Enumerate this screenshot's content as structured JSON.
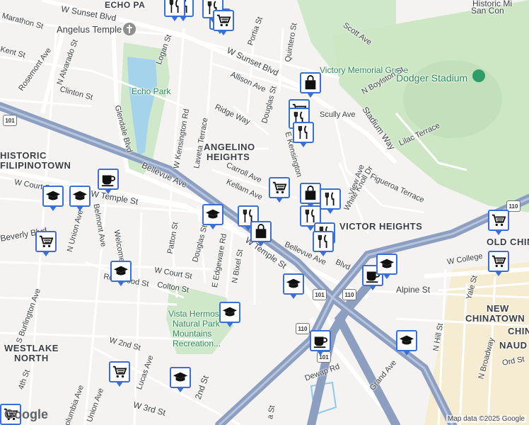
{
  "labels": {
    "echo_park_top": "ECHO PA",
    "historic_top": "Historic Mi",
    "san_top": "San Con",
    "sunset_top": "W Sunset Blvd",
    "marathon": "Marathon St",
    "angelus_temple": "Angelus Temple",
    "kent": "Kent St",
    "rosemont": "Rosemont Ave",
    "n_alvarado": "N Alvarado St",
    "logan": "Logan St",
    "portia": "Portia St",
    "quintero": "Quintero St",
    "scott": "Scott Ave",
    "w_sunset_mid": "W Sunset Blvd",
    "victory_memorial": "Victory Memorial Grove",
    "n_boylston": "N Boylston St",
    "dodger_stadium": "Dodger Stadium",
    "clinton": "Clinton St",
    "echo_park": "Echo Park",
    "allison": "Allison Ave",
    "douglas_n": "Douglas St",
    "scully": "Scully Ave",
    "stadium_way": "Stadium Way",
    "lilac": "Lilac Terrace",
    "glendale": "Glendale Blvd",
    "ridge_way": "Ridge Way",
    "w_kensington": "W Kensington Rd",
    "laveta": "Laveta Terrace",
    "angelino_heights_1": "ANGELINO",
    "angelino_heights_2": "HEIGHTS",
    "e_kensington": "E Kensington",
    "historic_filipinotown_1": "HISTORIC",
    "historic_filipinotown_2": "FILIPINOTOWN",
    "bellevue": "Bellevue Ave",
    "carroll": "Carroll Ave",
    "kellam": "Kellam Ave",
    "white_knoll": "White Knoll Dr",
    "figueroa_terrace": "Figueroa Terrace",
    "view_ave": "View Ave",
    "w_court_left": "W Court St",
    "w_temple_left": "W Temple St",
    "victor_heights": "VICTOR HEIGHTS",
    "old_chinatown": "OLD CHIN",
    "beverly": "Beverly Blvd",
    "n_union": "N Union Ave",
    "belmont": "Belmont Ave",
    "welcome": "Welcome St",
    "patton": "Patton St",
    "douglas_s": "Douglas St",
    "e_edgeware": "E Edgeware Rd",
    "n_bixel": "N Bixel St",
    "w_temple_mid": "W Temple St",
    "bellevue_2": "Bellevue Ave",
    "n_blvd": "Blvd",
    "w_college": "W College",
    "rockwood": "Rockwood St",
    "w_court_mid": "W Court St",
    "colton": "Colton St",
    "alpine": "Alpine St",
    "yale": "Yale St",
    "s_burlington": "S Burlington Ave",
    "vista_hermosa_1": "Vista Hermosa",
    "vista_hermosa_2": "Natural Park",
    "vista_hermosa_3": "Mountains",
    "vista_hermosa_4": "Recreation...",
    "new_chinatown_1": "NEW",
    "new_chinatown_2": "CHINATOWN",
    "chin_right": "CHIN",
    "westlake_1": "WESTLAKE",
    "westlake_2": "NORTH",
    "w_2nd": "W 2nd St",
    "n_hill": "N Hill St",
    "naud": "NAUD",
    "n_broadway": "N Broadway",
    "ord": "Ord St",
    "lucas": "Lucas Ave",
    "second_st": "2nd St",
    "dewap": "Dewap Rd",
    "grand_ave": "Grand Ave",
    "fourth": "4th St",
    "w_3rd": "W 3rd St",
    "columbia": "Columbia Ave",
    "union_ave": "Union Ave",
    "fa_st": "a St"
  },
  "shields": [
    "101",
    "101",
    "110",
    "110",
    "110",
    "101"
  ],
  "logo": "Google",
  "credit": "Map data ©2025 Google",
  "pois": [
    {
      "type": "shopping-cart"
    },
    {
      "type": "restaurant"
    },
    {
      "type": "restaurant"
    },
    {
      "type": "restaurant"
    },
    {
      "type": "shopping-cart"
    },
    {
      "type": "shopping-bag"
    },
    {
      "type": "shopping-cart"
    },
    {
      "type": "restaurant"
    },
    {
      "type": "restaurant"
    },
    {
      "type": "shopping-cart"
    },
    {
      "type": "shopping-bag"
    },
    {
      "type": "restaurant"
    },
    {
      "type": "restaurant"
    },
    {
      "type": "restaurant"
    },
    {
      "type": "school"
    },
    {
      "type": "restaurant"
    },
    {
      "type": "shopping-bag"
    },
    {
      "type": "restaurant"
    },
    {
      "type": "cafe"
    },
    {
      "type": "school"
    },
    {
      "type": "school"
    },
    {
      "type": "shopping-cart"
    },
    {
      "type": "school"
    },
    {
      "type": "school"
    },
    {
      "type": "cafe"
    },
    {
      "type": "school"
    },
    {
      "type": "shopping-cart"
    },
    {
      "type": "shopping-cart"
    },
    {
      "type": "shopping-cart"
    },
    {
      "type": "school"
    },
    {
      "type": "cafe"
    },
    {
      "type": "school"
    },
    {
      "type": "shopping-cart"
    },
    {
      "type": "school"
    }
  ]
}
